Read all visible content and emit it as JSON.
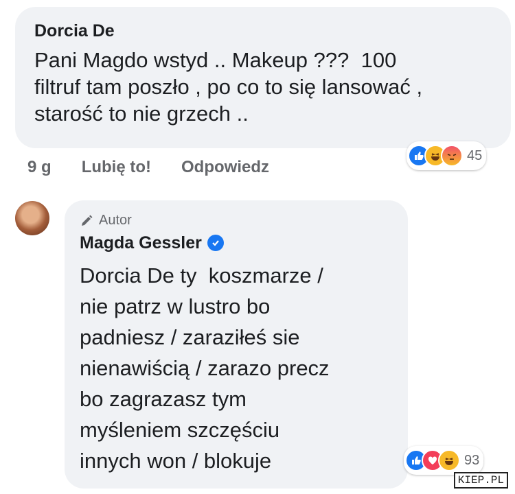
{
  "comment1": {
    "author": "Dorcia De",
    "text": "Pani Magdo wstyd .. Makeup ???  100\nfiltruf tam poszło , po co to się lansować ,\nstarość to nie grzech ..",
    "time": "9 g",
    "like_label": "Lubię to!",
    "reply_label": "Odpowiedz",
    "reactions": {
      "icons": [
        "like-icon",
        "haha-icon",
        "angry-icon"
      ],
      "count": "45"
    }
  },
  "reply": {
    "badge": "Autor",
    "author": "Magda Gessler",
    "text": "Dorcia De ty  koszmarze /\nnie patrz w lustro bo\npadniesz / zaraziłeś sie\nnienawiścią / zarazo precz\nbo zagrazasz tym\nmyśleniem szczęściu\ninnych won / blokuje",
    "reactions": {
      "icons": [
        "like-icon",
        "love-icon",
        "haha-icon"
      ],
      "count": "93"
    }
  },
  "watermark": "KIEP.PL",
  "colors": {
    "bubble": "#f0f2f5",
    "like": "#1877f2",
    "love": "#f33e58",
    "haha": "#f7b928",
    "meta": "#65676b"
  }
}
